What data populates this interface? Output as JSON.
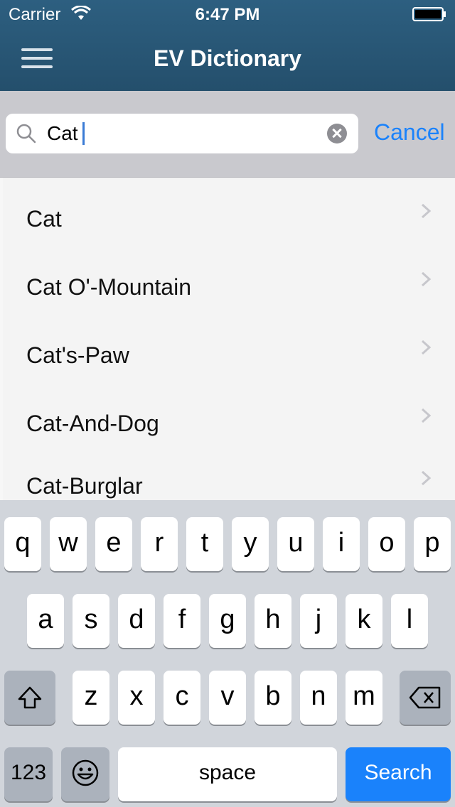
{
  "status_bar": {
    "carrier": "Carrier",
    "time": "6:47 PM"
  },
  "nav": {
    "title": "EV Dictionary",
    "menu_icon": "hamburger-menu-icon"
  },
  "search": {
    "value": "Cat",
    "cancel_label": "Cancel",
    "search_icon": "search-icon",
    "clear_icon": "clear-icon"
  },
  "results": [
    {
      "label": "Cat"
    },
    {
      "label": "Cat O'-Mountain"
    },
    {
      "label": "Cat's-Paw"
    },
    {
      "label": "Cat-And-Dog"
    },
    {
      "label": "Cat-Burglar"
    }
  ],
  "keyboard": {
    "row1": [
      "q",
      "w",
      "e",
      "r",
      "t",
      "y",
      "u",
      "i",
      "o",
      "p"
    ],
    "row2": [
      "a",
      "s",
      "d",
      "f",
      "g",
      "h",
      "j",
      "k",
      "l"
    ],
    "row3": [
      "z",
      "x",
      "c",
      "v",
      "b",
      "n",
      "m"
    ],
    "numbers_label": "123",
    "space_label": "space",
    "search_label": "Search",
    "shift_icon": "shift-icon",
    "delete_icon": "delete-icon",
    "emoji_icon": "emoji-icon"
  },
  "colors": {
    "nav_bar": "#2a5a7a",
    "accent": "#1a82fb",
    "keyboard_bg": "#d1d5db"
  }
}
